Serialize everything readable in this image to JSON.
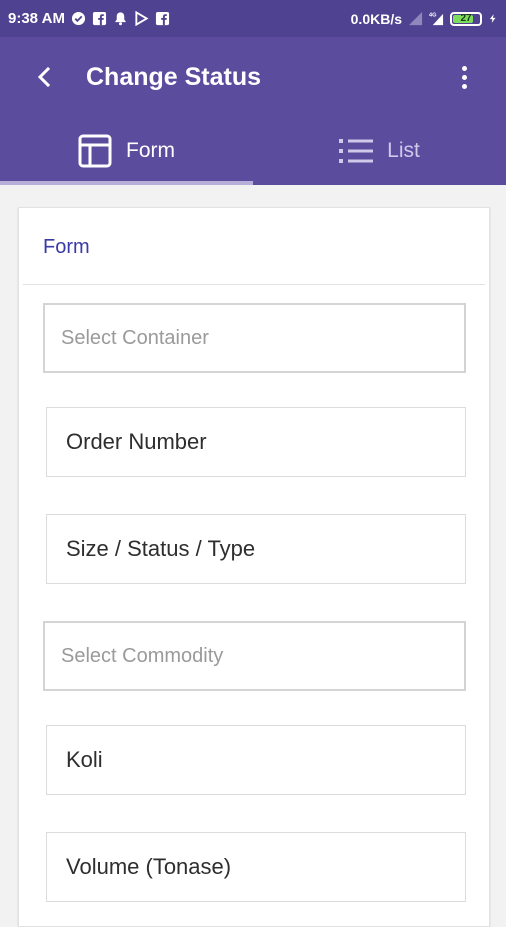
{
  "status_bar": {
    "time": "9:38 AM",
    "net_speed": "0.0KB/s",
    "battery": "27",
    "colors": {
      "bar": "#4f4391"
    }
  },
  "app_bar": {
    "title": "Change Status",
    "back_icon": "arrow-left-icon",
    "menu_icon": "more-vertical-icon",
    "color": "#5b4c9e"
  },
  "tabs": [
    {
      "label": "Form",
      "icon": "layout-icon",
      "active": true
    },
    {
      "label": "List",
      "icon": "list-icon",
      "active": false
    }
  ],
  "card": {
    "title": "Form",
    "title_color": "#3a3aa8",
    "fields": [
      {
        "kind": "select",
        "placeholder": "Select Container"
      },
      {
        "kind": "text",
        "value": "Order Number"
      },
      {
        "kind": "text",
        "value": "Size / Status / Type"
      },
      {
        "kind": "select",
        "placeholder": "Select Commodity"
      },
      {
        "kind": "text",
        "value": "Koli"
      },
      {
        "kind": "text",
        "value": "Volume (Tonase)"
      }
    ]
  }
}
